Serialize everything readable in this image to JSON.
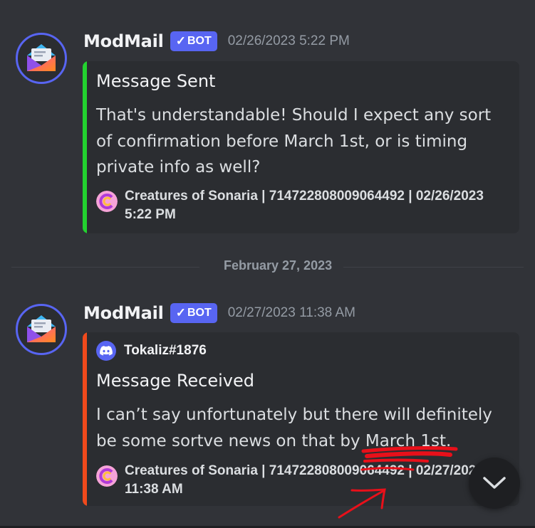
{
  "messages": [
    {
      "username": "ModMail",
      "bot_tag": "BOT",
      "timestamp": "02/26/2023 5:22 PM",
      "embed": {
        "bar_color": "#23d22f",
        "author": "",
        "title": "Message Sent",
        "description": "That's understandable! Should I expect any sort of confirmation before March 1st, or is timing private info as well?",
        "footer": "Creatures of Sonaria | 714722808009064492 | 02/26/2023 5:22 PM"
      }
    },
    {
      "username": "ModMail",
      "bot_tag": "BOT",
      "timestamp": "02/27/2023 11:38 AM",
      "embed": {
        "bar_color": "#f04a1c",
        "author": "Tokaliz#1876",
        "title": "Message Received",
        "description": "I can’t say unfortunately but there will definitely be some sortve news on that by March 1st.",
        "footer": "Creatures of Sonaria | 714722808009064492 | 02/27/2023 11:38 AM"
      }
    }
  ],
  "date_divider": "February 27, 2023",
  "icons": {
    "avatar": "modmail-envelope-icon",
    "author": "discord-logo-icon",
    "footer": "creatures-of-sonaria-icon",
    "scroll": "chevron-down-icon"
  },
  "colors": {
    "background": "#313338",
    "embed_background": "#2b2d31",
    "bot_tag": "#5865f2",
    "annotation": "#e8101a"
  }
}
